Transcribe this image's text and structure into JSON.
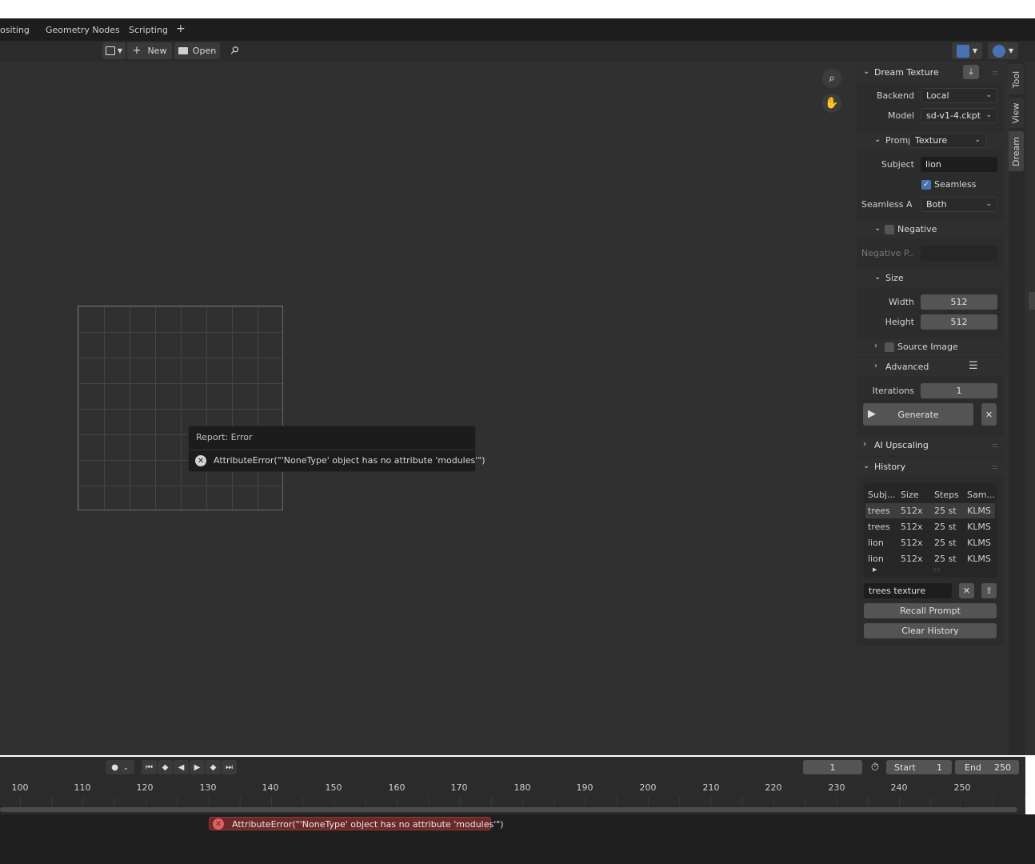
{
  "workspace_tabs": [
    "ositing",
    "Geometry Nodes",
    "Scripting",
    "+"
  ],
  "header": {
    "new_label": "New",
    "open_label": "Open"
  },
  "error_popup": {
    "title": "Report: Error",
    "message": "AttributeError(\"'NoneType' object has no attribute 'modules'\")"
  },
  "side_tabs": [
    "Tool",
    "View",
    "Dream"
  ],
  "panel": {
    "title": "Dream Texture",
    "backend_label": "Backend",
    "backend_value": "Local",
    "model_label": "Model",
    "model_value": "sd-v1-4.ckpt",
    "prompt_label": "Promp",
    "prompt_value": "Texture",
    "subject_label": "Subject",
    "subject_value": "lion",
    "seamless_label": "Seamless",
    "seamless_checked": true,
    "seamless_axes_label": "Seamless A",
    "seamless_axes_value": "Both",
    "negative_label": "Negative",
    "negative_prompt_label": "Negative P...",
    "size_label": "Size",
    "width_label": "Width",
    "width_value": "512",
    "height_label": "Height",
    "height_value": "512",
    "source_image_label": "Source Image",
    "advanced_label": "Advanced",
    "iterations_label": "Iterations",
    "iterations_value": "1",
    "generate_label": "Generate",
    "ai_upscaling_label": "AI Upscaling",
    "history_label": "History",
    "history_headers": [
      "Subj...",
      "Size",
      "Steps",
      "Sam..."
    ],
    "history_rows": [
      [
        "trees",
        "512x",
        "25 st",
        "KLMS"
      ],
      [
        "trees",
        "512x",
        "25 st",
        "KLMS"
      ],
      [
        "lion",
        "512x",
        "25 st",
        "KLMS"
      ],
      [
        "lion",
        "512x",
        "25 st",
        "KLMS"
      ]
    ],
    "history_selected_prompt": "trees texture",
    "recall_prompt_label": "Recall Prompt",
    "clear_history_label": "Clear History"
  },
  "timeline": {
    "current_frame": "1",
    "start_label": "Start",
    "start_value": "1",
    "end_label": "End",
    "end_value": "250",
    "ruler_ticks": [
      "100",
      "110",
      "120",
      "130",
      "140",
      "150",
      "160",
      "170",
      "180",
      "190",
      "200",
      "210",
      "220",
      "230",
      "240",
      "250"
    ]
  },
  "status_bar": {
    "error_message": "AttributeError(\"'NoneType' object has no attribute 'modules'\")"
  },
  "colors": {
    "accent": "#4772b3",
    "error_bg": "#6b2a2a",
    "viewport_bg": "#303030"
  }
}
